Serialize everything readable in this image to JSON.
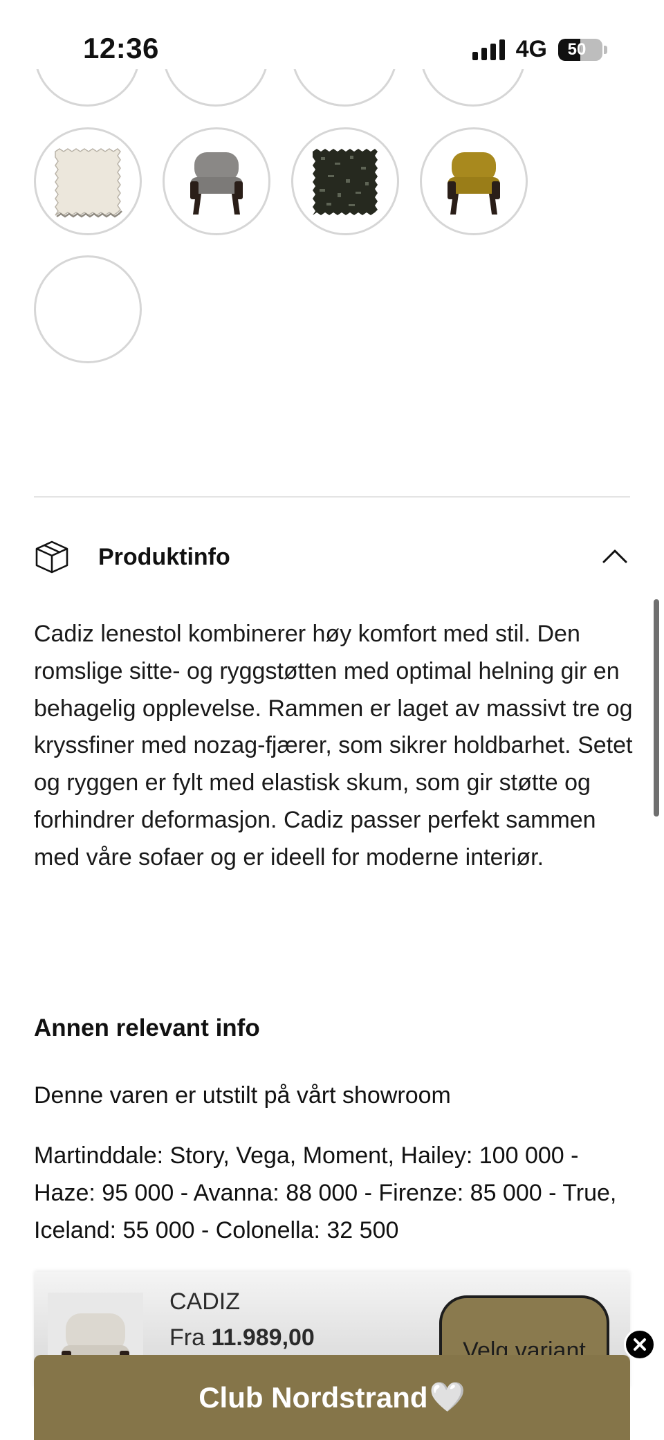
{
  "status_bar": {
    "time": "12:36",
    "network": "4G",
    "battery_percent": "50"
  },
  "swatches": [
    {
      "kind": "fabric",
      "name": "cream-fabric-swatch",
      "color": "#ece7dc"
    },
    {
      "kind": "chair",
      "name": "grey-chair-variant",
      "color": "#8a8886"
    },
    {
      "kind": "fabric",
      "name": "dark-fabric-swatch",
      "color": "#26291f"
    },
    {
      "kind": "chair",
      "name": "mustard-chair-variant",
      "color": "#a8891e"
    },
    {
      "kind": "empty",
      "name": "empty-swatch"
    }
  ],
  "product_info": {
    "title": "Produktinfo",
    "description": "Cadiz lenestol kombinerer høy komfort med stil. Den romslige sitte- og ryggstøtten med optimal helning gir en behagelig opplevelse. Rammen er laget av massivt tre og kryssfiner med nozag-fjærer, som sikrer holdbarhet. Setet og ryggen er fylt med elastisk skum, som gir støtte og forhindrer deformasjon. Cadiz passer perfekt sammen med våre sofaer og er ideell for moderne interiør.",
    "other_heading": "Annen relevant info",
    "showroom_text": "Denne varen er utstilt på vårt showroom",
    "prices_text": "Martinddale: Story, Vega, Moment, Hailey: 100 000 - Haze: 95 000 - Avanna: 88 000 - Firenze: 85 000 - True, Iceland: 55 000 - Colonella: 32 500"
  },
  "sticky_bar": {
    "product_name": "CADIZ",
    "price_prefix": "Fra",
    "price": "11.989,00",
    "button_label": "Velg variant"
  },
  "banner": {
    "label": "Club Nordstrand",
    "heart": "🤍"
  },
  "colors": {
    "banner": "#857549",
    "accent_button": "#8a7a4e"
  }
}
